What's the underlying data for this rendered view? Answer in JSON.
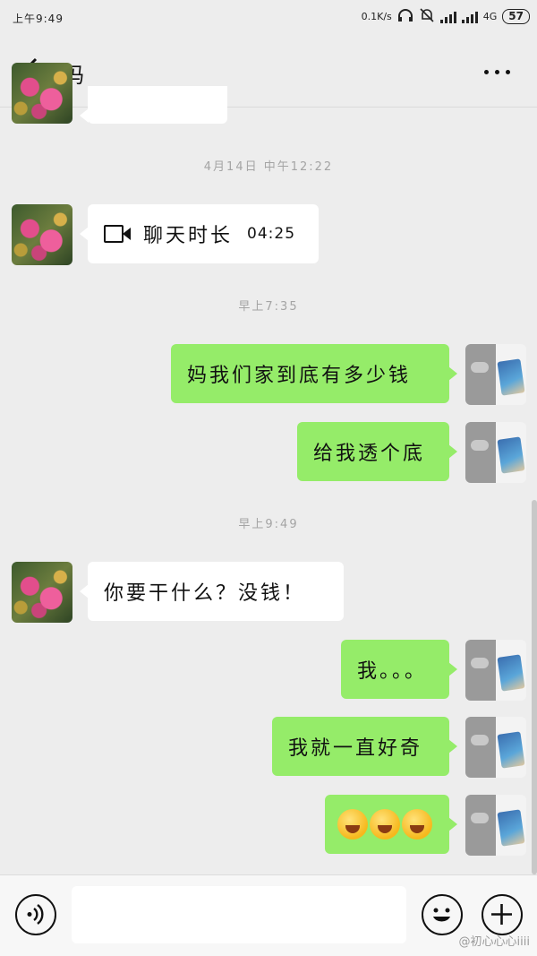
{
  "status_bar": {
    "time": "上午9:49",
    "network_speed": "0.1K/s",
    "network_type": "4G",
    "battery": "57"
  },
  "header": {
    "title": "妈"
  },
  "messages": {
    "ts1": "4月14日 中午12:22",
    "call_label": "聊天时长",
    "call_duration": "04:25",
    "ts2": "早上7:35",
    "m1": "妈我们家到底有多少钱",
    "m2": "给我透个底",
    "ts3": "早上9:49",
    "m3": "你要干什么？没钱！",
    "m4": "我。。。",
    "m5": "我就一直好奇",
    "m6_emoji": "face-with-tears-of-joy x3"
  },
  "footer": {
    "watermark": "@初心心心iiii"
  },
  "colors": {
    "background": "#ededed",
    "bubble_self": "#95ec69",
    "bubble_other": "#ffffff"
  }
}
